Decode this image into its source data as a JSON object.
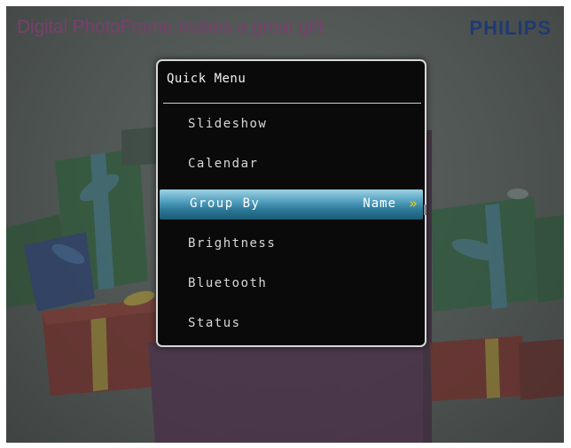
{
  "header": {
    "headline": "Digital PhotoFrame makes a great gift",
    "brand": "PHILIPS"
  },
  "menu": {
    "title": "Quick Menu",
    "items": [
      {
        "label": "Slideshow"
      },
      {
        "label": "Calendar"
      },
      {
        "label": "Group By",
        "value": "Name",
        "selected": true
      },
      {
        "label": "Brightness"
      },
      {
        "label": "Bluetooth"
      },
      {
        "label": "Status"
      }
    ]
  },
  "icons": {
    "selected_arrow": "double-chevron-right-icon",
    "brand_logo": "philips-shield-icon"
  },
  "colors": {
    "headline": "#7a3f6c",
    "brand": "#1f3a72",
    "menu_background": "#0a0a0a",
    "selection_highlight": "#5aa6c4",
    "arrow": "#f0d000"
  }
}
